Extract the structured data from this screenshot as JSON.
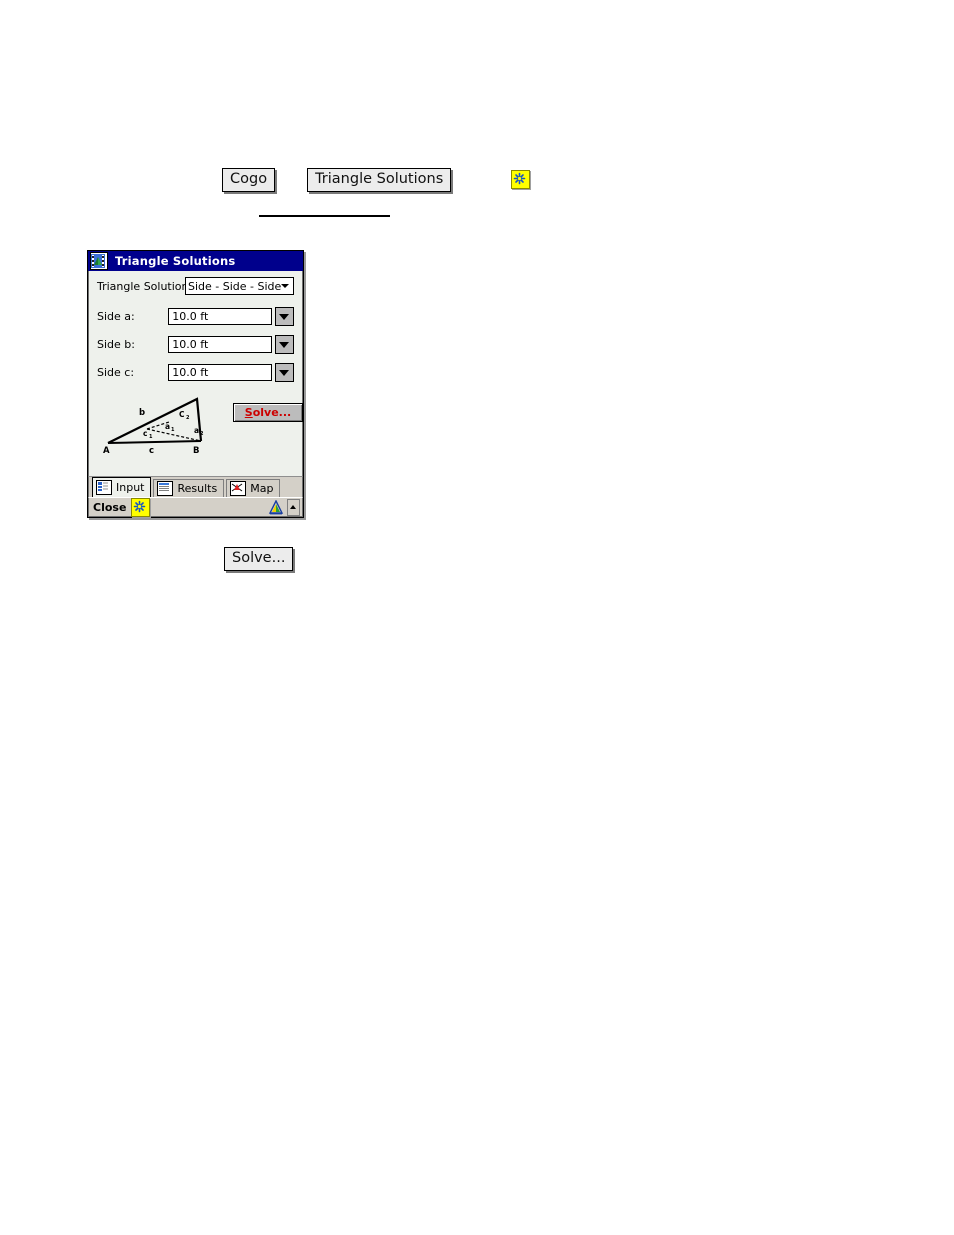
{
  "topbar": {
    "cogo_label": "Cogo",
    "triangle_solutions_label": "Triangle Solutions",
    "asterisk_icon": "asterisk-icon"
  },
  "dialog": {
    "title": "Triangle Solutions",
    "title_icon": "triangle-solutions-app-icon",
    "solution_row": {
      "label": "Triangle Solution:",
      "value": "Side - Side - Side"
    },
    "fields": [
      {
        "label": "Side a:",
        "value": "10.0 ft"
      },
      {
        "label": "Side b:",
        "value": "10.0 ft"
      },
      {
        "label": "Side c:",
        "value": "10.0 ft"
      }
    ],
    "solve_button": {
      "accel": "S",
      "rest": "olve..."
    },
    "diagram": {
      "vertex_a": "A",
      "vertex_b": "B",
      "side_b": "b",
      "side_c": "c",
      "label_c1": "c",
      "label_c1_sub": "1",
      "label_c2": "C",
      "label_c2_sub": "2",
      "label_a1": "a",
      "label_a1_sub": "1",
      "label_a2": "a",
      "label_a2_sub": "2"
    },
    "tabs": [
      {
        "label": "Input",
        "icon": "input-form-icon",
        "active": true
      },
      {
        "label": "Results",
        "icon": "results-list-icon",
        "active": false
      },
      {
        "label": "Map",
        "icon": "map-view-icon",
        "active": false
      }
    ],
    "statusbar": {
      "close_label": "Close",
      "close_icon": "asterisk-icon",
      "survey_icon": "survey-instrument-icon",
      "scroll_up_icon": "scroll-up-icon"
    }
  },
  "bottom": {
    "solve_label": "Solve..."
  },
  "colors": {
    "titlebar": "#00008c",
    "accent_yellow": "#ffff00",
    "solve_text": "#cc0000",
    "dialog_face": "#d4d0c8",
    "client_bg": "#eef1ec"
  }
}
